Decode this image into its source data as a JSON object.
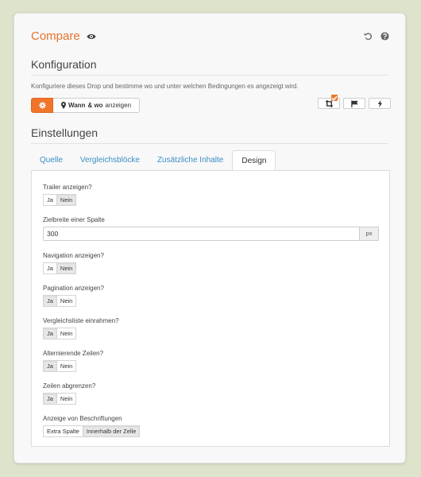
{
  "header": {
    "title": "Compare"
  },
  "config": {
    "title": "Konfiguration",
    "description": "Konfiguriere dieses Drop und bestimme wo und unter welchen Bedingungen es angezeigt wird.",
    "wann_part1": "Wann",
    "wann_part2": "& wo",
    "wann_part3": "anzeigen"
  },
  "settings": {
    "title": "Einstellungen"
  },
  "tabs": [
    {
      "label": "Quelle"
    },
    {
      "label": "Vergleichsblöcke"
    },
    {
      "label": "Zusätzliche Inhalte"
    },
    {
      "label": "Design"
    }
  ],
  "fields": {
    "trailer": {
      "label": "Trailer anzeigen?",
      "yes": "Ja",
      "no": "Nein"
    },
    "width": {
      "label": "Zielbreite einer Spalte",
      "value": "300",
      "unit": "px"
    },
    "navigation": {
      "label": "Navigation anzeigen?",
      "yes": "Ja",
      "no": "Nein"
    },
    "pagination": {
      "label": "Pagination anzeigen?",
      "yes": "Ja",
      "no": "Nein"
    },
    "frame": {
      "label": "Vergleichsliste einrahmen?",
      "yes": "Ja",
      "no": "Nein"
    },
    "alternating": {
      "label": "Alternierende Zeilen?",
      "yes": "Ja",
      "no": "Nein"
    },
    "borders": {
      "label": "Zeilen abgrenzen?",
      "yes": "Ja",
      "no": "Nein"
    },
    "captions": {
      "label": "Anzeige von Beschriftungen",
      "opt1": "Extra Spalte",
      "opt2": "Innerhalb der Zelle"
    }
  },
  "colors": {
    "accent": "#f0752b",
    "link": "#3a8fc4",
    "background": "#dde4cb"
  }
}
